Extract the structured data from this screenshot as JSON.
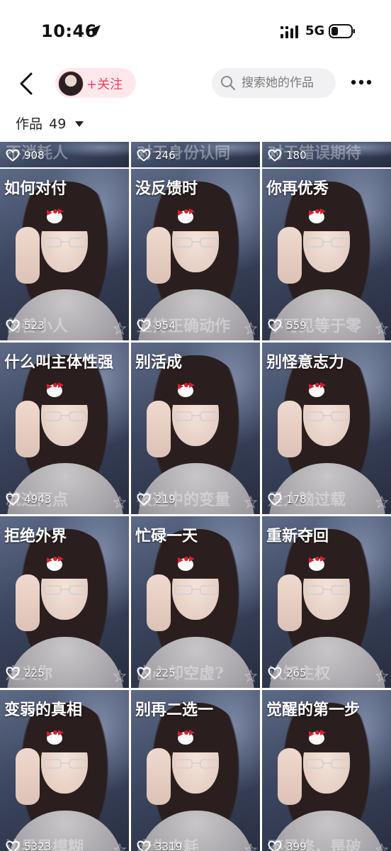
{
  "status_bar": {
    "time": "10:46",
    "network": "5G"
  },
  "header": {
    "follow_label": "+关注",
    "search_placeholder": "搜索她的作品"
  },
  "works": {
    "label": "作品",
    "count": "49"
  },
  "top_row": [
    {
      "likes": "908",
      "sub": "不消耗人"
    },
    {
      "likes": "246",
      "sub": "对于身份认同"
    },
    {
      "likes": "180",
      "sub": "对于错误期待"
    }
  ],
  "rows": [
    [
      {
        "title": "如何对付",
        "likes": "523",
        "sub": "伪善小人"
      },
      {
        "title": "没反馈时",
        "likes": "954",
        "sub": "坚持正确动作"
      },
      {
        "title": "你再优秀",
        "likes": "559",
        "sub": "不可见等于零"
      }
    ],
    [
      {
        "title": "什么叫主体性强",
        "likes": "4943",
        "sub": "就这两点"
      },
      {
        "title": "别活成",
        "likes": "219",
        "sub": "被选中的变量"
      },
      {
        "title": "别怪意志力",
        "likes": "178",
        "sub": "是大脑过载"
      }
    ],
    [
      {
        "title": "拒绝外界",
        "likes": "225",
        "sub": "定义你"
      },
      {
        "title": "忙碌一天",
        "likes": "225",
        "sub": "内心却空虚?"
      },
      {
        "title": "重新夺回",
        "likes": "265",
        "sub": "认知主权"
      }
    ],
    [
      {
        "title": "变弱的真相",
        "likes": "5323",
        "sub": "边界是模糊"
      },
      {
        "title": "别再二选一",
        "likes": "3319",
        "sub": "产生内耗"
      },
      {
        "title": "觉醒的第一步",
        "likes": "399",
        "sub": "不是修，是破"
      }
    ]
  ]
}
